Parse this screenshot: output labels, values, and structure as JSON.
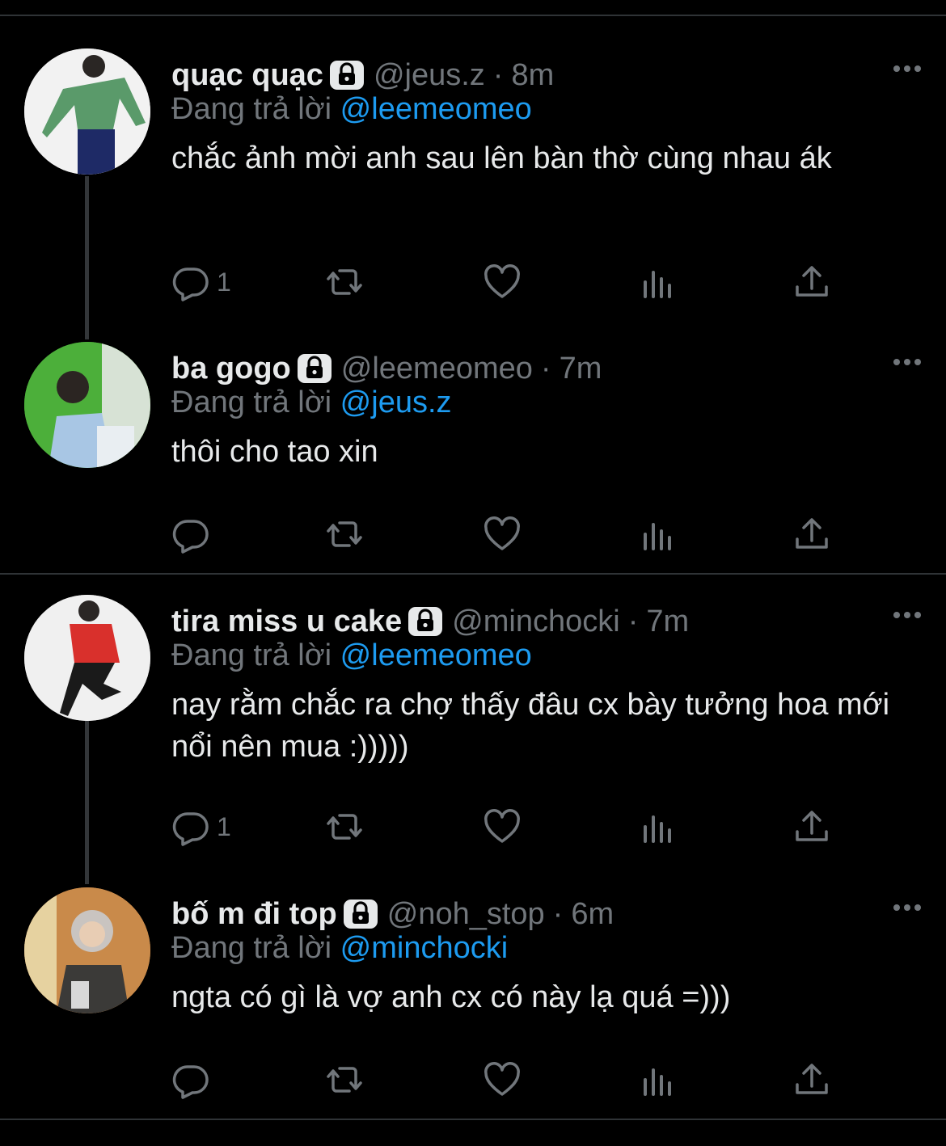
{
  "tweets": [
    {
      "name": "quạc quạc",
      "handle": "@jeus.z",
      "time": "8m",
      "reply_label": "Đang trả lời",
      "reply_to": "@leemeomeo",
      "text": "chắc ảnh mời anh sau lên bàn thờ cùng nhau ák",
      "reply_count": "1",
      "avatar_bg": "#f2f2f2"
    },
    {
      "name": "ba gogo",
      "handle": "@leemeomeo",
      "time": "7m",
      "reply_label": "Đang trả lời",
      "reply_to": "@jeus.z",
      "text": "thôi cho tao xin",
      "reply_count": "",
      "avatar_bg": "#4caf3a"
    },
    {
      "name": "tira miss u cake",
      "handle": "@minchocki",
      "time": "7m",
      "reply_label": "Đang trả lời",
      "reply_to": "@leemeomeo",
      "text": "nay rằm chắc ra chợ thấy đâu cx bày tưởng hoa mới nổi nên mua :)))))",
      "reply_count": "1",
      "avatar_bg": "#f0f0f0"
    },
    {
      "name": "bố m đi top",
      "handle": "@noh_stop",
      "time": "6m",
      "reply_label": "Đang trả lời",
      "reply_to": "@minchocki",
      "text": "ngta có gì là vợ anh cx có này lạ quá =)))",
      "reply_count": "",
      "avatar_bg": "#c98a4a"
    }
  ],
  "separator": "·",
  "icons": [
    "lock-icon",
    "more-icon",
    "reply-icon",
    "retweet-icon",
    "like-icon",
    "views-icon",
    "share-icon"
  ],
  "colors": {
    "background": "#000000",
    "text": "#e7e9ea",
    "muted": "#71767b",
    "mention": "#1d9bf0"
  }
}
